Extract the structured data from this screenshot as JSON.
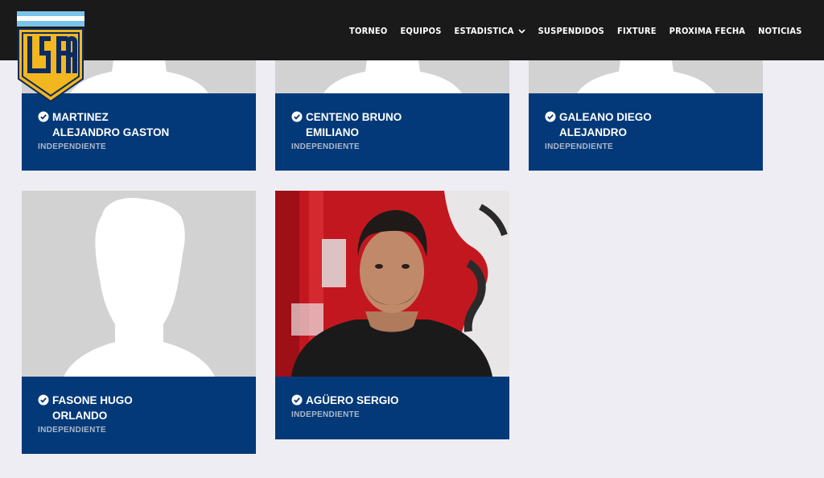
{
  "nav": {
    "items": [
      {
        "label": "TORNEO"
      },
      {
        "label": "EQUIPOS"
      },
      {
        "label": "ESTADISTICA",
        "has_dropdown": true
      },
      {
        "label": "SUSPENDIDOS"
      },
      {
        "label": "FIXTURE"
      },
      {
        "label": "PROXIMA FECHA"
      },
      {
        "label": "NOTICIAS"
      }
    ]
  },
  "logo": {
    "text": "LSFA",
    "colors": {
      "gold": "#f2b71f",
      "sky": "#7ac3ea",
      "white": "#ffffff"
    }
  },
  "players": [
    {
      "name_line1": "MARTINEZ",
      "name_line2": "ALEJANDRO GASTON",
      "team": "INDEPENDIENTE",
      "photo": "placeholder-silhouette"
    },
    {
      "name_line1": "CENTENO BRUNO",
      "name_line2": "EMILIANO",
      "team": "INDEPENDIENTE",
      "photo": "placeholder-silhouette"
    },
    {
      "name_line1": "GALEANO DIEGO",
      "name_line2": "ALEJANDRO",
      "team": "INDEPENDIENTE",
      "photo": "placeholder-silhouette"
    },
    {
      "name_line1": "FASONE HUGO",
      "name_line2": "ORLANDO",
      "team": "INDEPENDIENTE",
      "photo": "placeholder-silhouette"
    },
    {
      "name_line1": "AGÜERO SERGIO",
      "name_line2": "",
      "team": "INDEPENDIENTE",
      "photo": "player-photo"
    }
  ],
  "colors": {
    "header_bg": "#1b1a1a",
    "card_blue": "#033978",
    "page_bg": "#eeedf4",
    "placeholder_bg": "#d2d2d2"
  }
}
